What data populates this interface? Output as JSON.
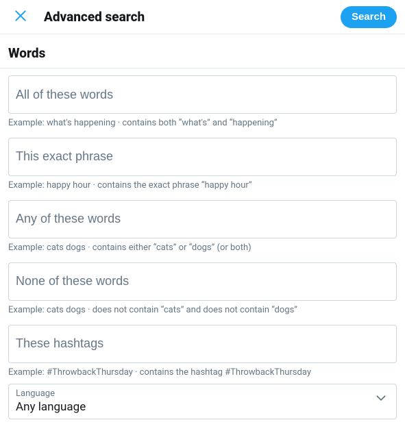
{
  "header": {
    "title": "Advanced search",
    "search_button": "Search"
  },
  "section": {
    "words_heading": "Words"
  },
  "fields": {
    "all_words": {
      "placeholder": "All of these words",
      "hint": "Example: what's happening · contains both “what's” and “happening”"
    },
    "exact_phrase": {
      "placeholder": "This exact phrase",
      "hint": "Example: happy hour · contains the exact phrase “happy hour”"
    },
    "any_words": {
      "placeholder": "Any of these words",
      "hint": "Example: cats dogs · contains either “cats” or “dogs” (or both)"
    },
    "none_words": {
      "placeholder": "None of these words",
      "hint": "Example: cats dogs · does not contain “cats” and does not contain “dogs”"
    },
    "hashtags": {
      "placeholder": "These hashtags",
      "hint": "Example: #ThrowbackThursday · contains the hashtag #ThrowbackThursday"
    }
  },
  "language": {
    "label": "Language",
    "value": "Any language"
  },
  "colors": {
    "accent": "#1da1f2"
  }
}
